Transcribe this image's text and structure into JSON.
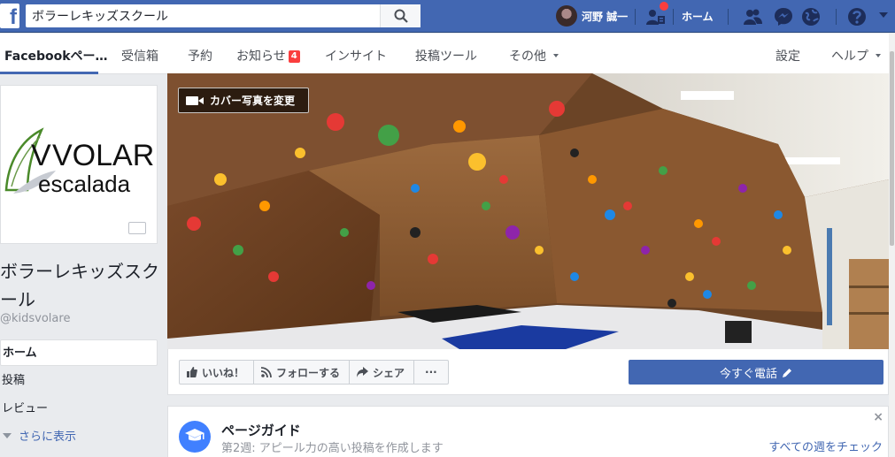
{
  "topbar": {
    "logo": "f",
    "search_value": "ボラーレキッズスクール",
    "user_name": "河野 誠一",
    "home_label": "ホーム"
  },
  "page_nav": {
    "items": [
      {
        "label": "Facebookペー…"
      },
      {
        "label": "受信箱"
      },
      {
        "label": "予約"
      },
      {
        "label": "お知らせ",
        "badge": "4"
      },
      {
        "label": "インサイト"
      },
      {
        "label": "投稿ツール"
      },
      {
        "label": "その他"
      },
      {
        "label": "設定"
      },
      {
        "label": "ヘルプ"
      }
    ]
  },
  "logo": {
    "line1": "VOLARE",
    "line2": "escalada"
  },
  "page": {
    "name": "ボラーレキッズスクール",
    "handle": "@kidsvolare"
  },
  "left_nav": {
    "items": [
      {
        "label": "ホーム"
      },
      {
        "label": "投稿"
      },
      {
        "label": "レビュー"
      }
    ],
    "see_more": "さらに表示"
  },
  "cover": {
    "change_label": "カバー写真を変更"
  },
  "actions": {
    "like": "いいね！",
    "follow": "フォローする",
    "share": "シェア",
    "more": "···",
    "call": "今すぐ電話"
  },
  "guide": {
    "title": "ページガイド",
    "subtitle": "第2週: アピール力の高い投稿を作成します",
    "link": "すべての週をチェック",
    "close": "×"
  },
  "colors": {
    "brand": "#4267b2",
    "notify": "#fa3e3e",
    "guide_icon": "#4080ff"
  }
}
